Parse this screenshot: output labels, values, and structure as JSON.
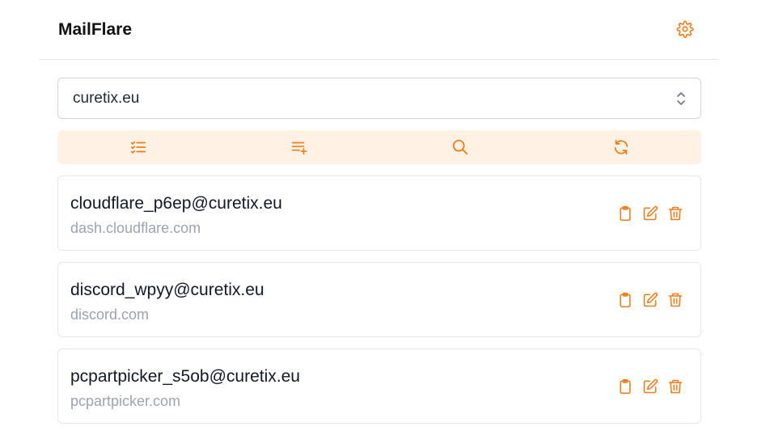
{
  "app": {
    "title": "MailFlare",
    "accent_color": "#f07d1c",
    "settings_icon": "gear-icon"
  },
  "domain_select": {
    "value": "curetix.eu",
    "icon": "chevron-up-down-icon"
  },
  "toolbar": {
    "background": "#fff1e4",
    "buttons": [
      {
        "name": "select-list",
        "icon": "checklist-icon"
      },
      {
        "name": "add-email",
        "icon": "list-plus-icon"
      },
      {
        "name": "search",
        "icon": "search-icon"
      },
      {
        "name": "refresh",
        "icon": "refresh-icon"
      }
    ]
  },
  "emails": [
    {
      "address": "cloudflare_p6ep@curetix.eu",
      "site": "dash.cloudflare.com"
    },
    {
      "address": "discord_wpyy@curetix.eu",
      "site": "discord.com"
    },
    {
      "address": "pcpartpicker_s5ob@curetix.eu",
      "site": "pcpartpicker.com"
    }
  ],
  "card_actions": [
    {
      "name": "copy",
      "icon": "clipboard-icon"
    },
    {
      "name": "edit",
      "icon": "edit-icon"
    },
    {
      "name": "delete",
      "icon": "trash-icon"
    }
  ]
}
